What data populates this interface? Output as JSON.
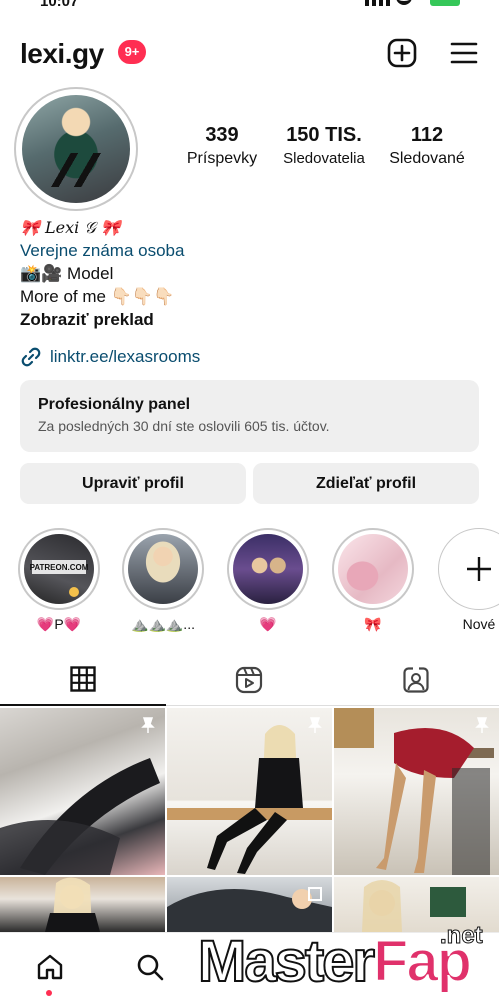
{
  "status_bar": {
    "time": "10:07"
  },
  "header": {
    "username": "lexi.gy",
    "notification_badge": "9+",
    "icons": [
      "plus-square-icon",
      "hamburger-menu-icon"
    ]
  },
  "profile": {
    "stats": [
      {
        "value": "339",
        "label": "Príspevky"
      },
      {
        "value": "150 TIS.",
        "label": "Sledovatelia"
      },
      {
        "value": "112",
        "label": "Sledované"
      }
    ],
    "bio": {
      "name": "🎀 𝐿𝑒𝑥𝑖 𝒢 🎀",
      "category": "Verejne známa osoba",
      "line1": "📸🎥 Model",
      "line2": "More of me 👇🏻👇🏻👇🏻",
      "translate": "Zobraziť preklad",
      "link": "linktr.ee/lexasrooms"
    },
    "pro_panel": {
      "title": "Profesionálny panel",
      "subtitle": "Za posledných 30 dní ste oslovili 605 tis. účtov."
    },
    "buttons": {
      "edit": "Upraviť profil",
      "share": "Zdieľať profil"
    }
  },
  "highlights": [
    {
      "caption": "💗P💗",
      "image_text": "PATREON.COM"
    },
    {
      "caption": "⛰️⛰️⛰️..."
    },
    {
      "caption": "💗"
    },
    {
      "caption": "🎀"
    },
    {
      "caption": "Nové"
    }
  ],
  "tabs": [
    "grid-icon",
    "reels-icon",
    "tagged-icon"
  ],
  "bottom_nav": [
    "home-icon",
    "search-icon"
  ],
  "watermark": {
    "main": "Master",
    "accent": "Fap",
    "tld": ".net"
  }
}
